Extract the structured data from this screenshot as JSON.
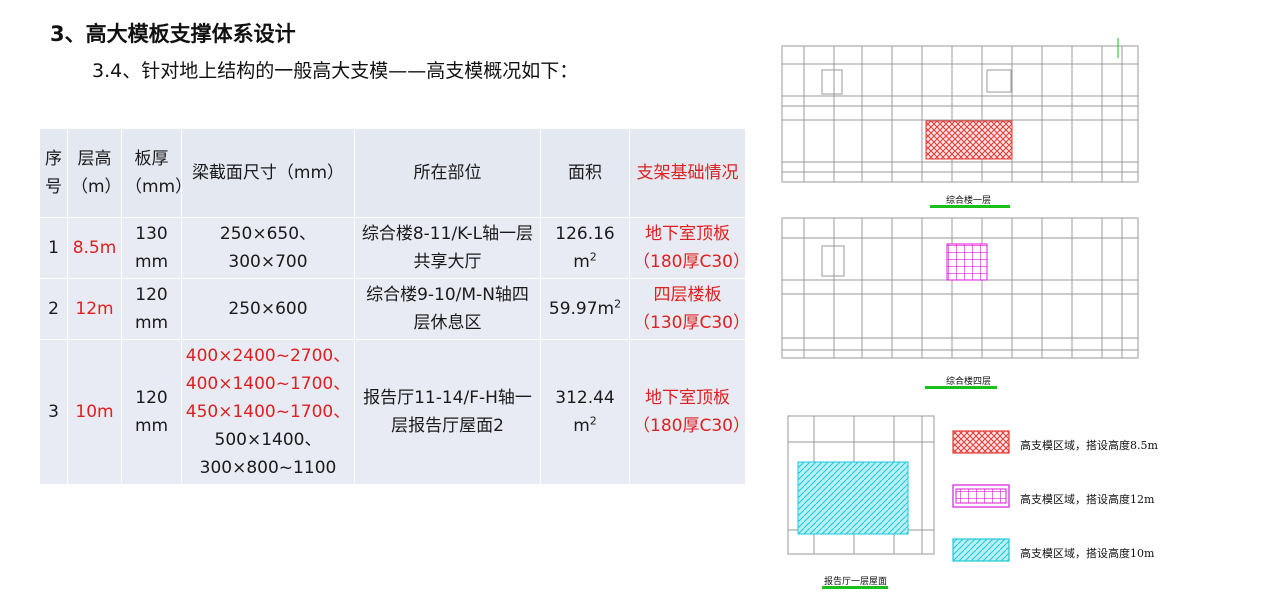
{
  "header": {
    "title": "3、高大模板支撑体系设计",
    "subtitle": "3.4、针对地上结构的一般高大支模——高支模概况如下："
  },
  "table": {
    "columns": [
      "序号",
      "层高（m）",
      "板厚（mm）",
      "梁截面尺寸（mm）",
      "所在部位",
      "面积",
      "支架基础情况"
    ],
    "rows": [
      {
        "no": "1",
        "height": "8.5m",
        "thickness": "130 mm",
        "beam_lines": [
          "250×650、",
          "300×700"
        ],
        "location": "综合楼8-11/K-L轴一层共享大厅",
        "area": "126.16 m",
        "area_sup": "2",
        "foundation": "地下室顶板（180厚C30）"
      },
      {
        "no": "2",
        "height": "12m",
        "thickness": "120 mm",
        "beam_lines": [
          "250×600"
        ],
        "location": "综合楼9-10/M-N轴四层休息区",
        "area": "59.97m",
        "area_sup": "2",
        "foundation": "四层楼板（130厚C30）"
      },
      {
        "no": "3",
        "height": "10m",
        "thickness": "120 mm",
        "beam_lines_red": [
          "400×2400~2700、",
          "400×1400~1700、",
          "450×1400~1700、"
        ],
        "beam_lines": [
          "500×1400、",
          "300×800~1100"
        ],
        "location": "报告厅11-14/F-H轴一层报告厅屋面2",
        "area": "312.44 m",
        "area_sup": "2",
        "foundation": "地下室顶板（180厚C30）"
      }
    ]
  },
  "drawings": {
    "captions": [
      "综合楼一层",
      "综合楼四层",
      "报告厅一层屋面"
    ]
  },
  "legend": [
    {
      "text": "高支模区域，搭设高度8.5m",
      "pattern": "crosshatch-red"
    },
    {
      "text": "高支模区域，搭设高度12m",
      "pattern": "grid-magenta"
    },
    {
      "text": "高支模区域，搭设高度10m",
      "pattern": "diagonal-cyan"
    }
  ],
  "colors": {
    "red": "#e02020",
    "table_bg": "#e8ebf3",
    "hatch_red": "#e53935",
    "hatch_magenta": "#d81bd8",
    "hatch_cyan": "#1ec8d8",
    "caption_underline": "#19c019"
  }
}
